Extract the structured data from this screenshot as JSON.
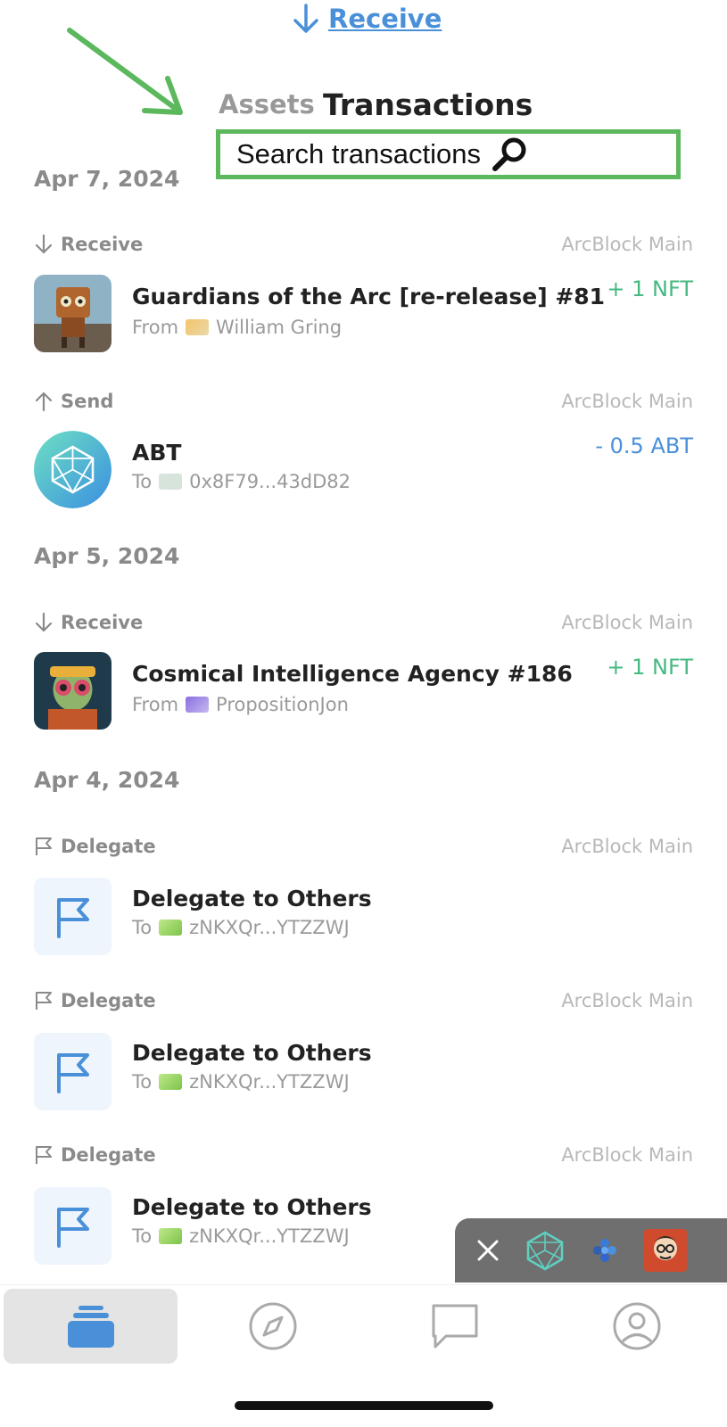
{
  "header": {
    "receive_label": "Receive"
  },
  "tabs": {
    "assets": "Assets",
    "transactions": "Transactions"
  },
  "search": {
    "placeholder": "Search transactions"
  },
  "groups": [
    {
      "date": "Apr 7, 2024",
      "items": [
        {
          "type": "Receive",
          "network": "ArcBlock Main",
          "title": "Guardians of the Arc [re-release] #81",
          "direction": "From",
          "party": "William Gring",
          "amount": "+ 1 NFT"
        },
        {
          "type": "Send",
          "network": "ArcBlock Main",
          "title": "ABT",
          "direction": "To",
          "party": "0x8F79...43dD82",
          "amount": "- 0.5 ABT"
        }
      ]
    },
    {
      "date": "Apr 5, 2024",
      "items": [
        {
          "type": "Receive",
          "network": "ArcBlock Main",
          "title": "Cosmical Intelligence Agency #186",
          "direction": "From",
          "party": "PropositionJon",
          "amount": "+ 1 NFT"
        }
      ]
    },
    {
      "date": "Apr 4, 2024",
      "items": [
        {
          "type": "Delegate",
          "network": "ArcBlock Main",
          "title": "Delegate to Others",
          "direction": "To",
          "party": "zNKXQr...YTZZWJ",
          "amount": ""
        },
        {
          "type": "Delegate",
          "network": "ArcBlock Main",
          "title": "Delegate to Others",
          "direction": "To",
          "party": "zNKXQr...YTZZWJ",
          "amount": ""
        },
        {
          "type": "Delegate",
          "network": "ArcBlock Main",
          "title": "Delegate to Others",
          "direction": "To",
          "party": "zNKXQr...YTZZWJ",
          "amount": ""
        }
      ]
    }
  ],
  "colors": {
    "accent": "#4a90d9",
    "positive": "#47b881",
    "annotation": "#5cb85c"
  },
  "nav": {
    "items": [
      "wallet-icon",
      "compass-icon",
      "chat-icon",
      "profile-icon"
    ],
    "active": "wallet-icon"
  }
}
